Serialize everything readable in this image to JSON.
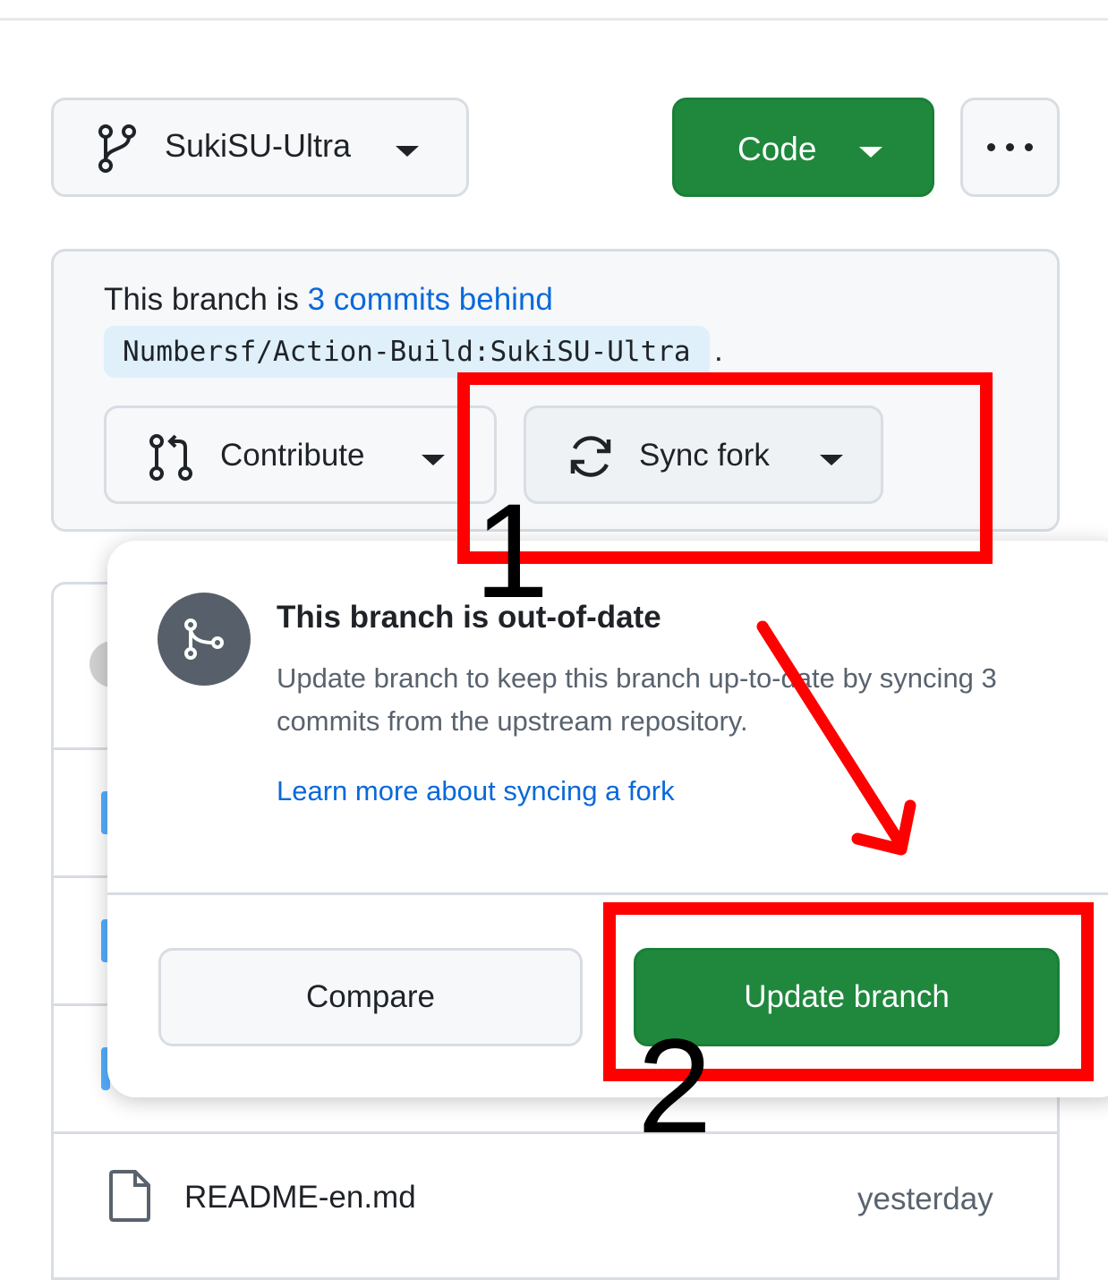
{
  "header": {
    "branch_name": "SukiSU-Ultra",
    "code_label": "Code"
  },
  "status": {
    "prefix": "This branch is ",
    "behind_link": "3 commits behind",
    "upstream_ref": "Numbersf/Action-Build:SukiSU-Ultra",
    "suffix": "."
  },
  "actions": {
    "contribute_label": "Contribute",
    "sync_label": "Sync fork"
  },
  "popover": {
    "title": "This branch is out-of-date",
    "description": "Update branch to keep this branch up-to-date by syncing 3 commits from the upstream repository.",
    "learn_more": "Learn more about syncing a fork",
    "compare_label": "Compare",
    "update_label": "Update branch"
  },
  "files": {
    "readme_name": "README-en.md",
    "readme_time": "yesterday"
  },
  "annotations": {
    "step1": "1",
    "step2": "2",
    "color": "#ff0000"
  },
  "colors": {
    "primary_green": "#1f883d",
    "link_blue": "#0969da"
  },
  "icons": [
    "git-branch-icon",
    "caret-down-icon",
    "kebab-menu-icon",
    "git-pull-request-icon",
    "sync-icon",
    "git-merge-icon",
    "file-icon"
  ]
}
